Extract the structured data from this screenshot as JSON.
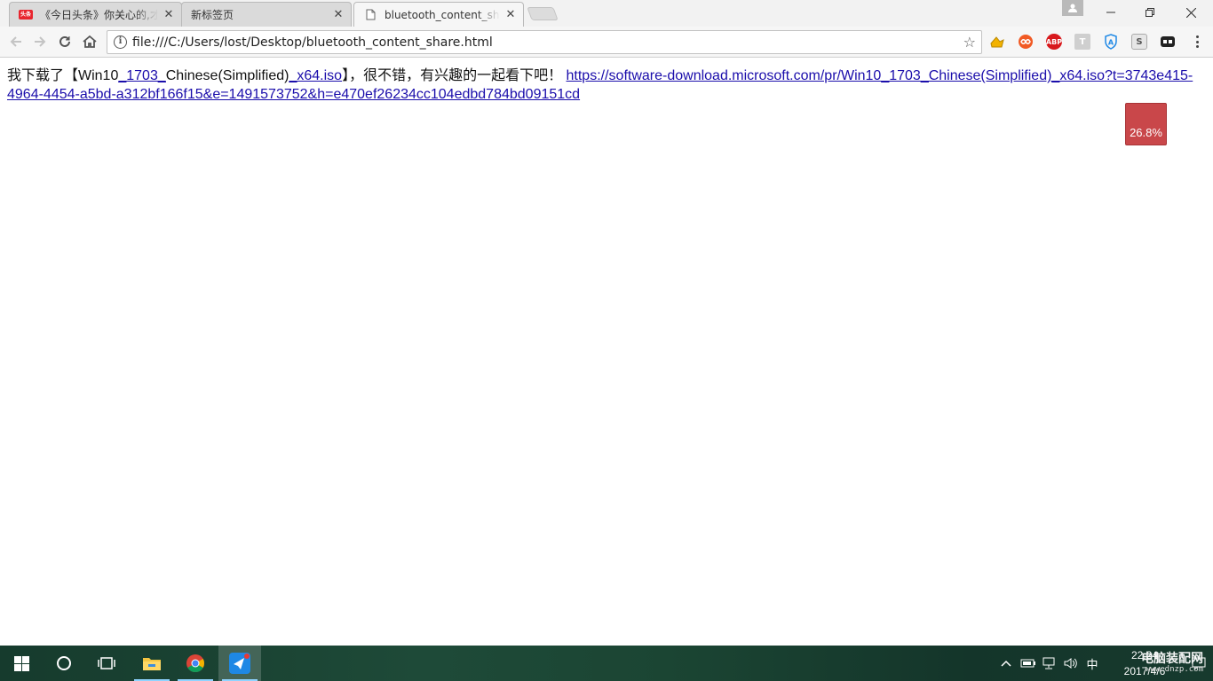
{
  "tabs": [
    {
      "title": "《今日头条》你关心的,才是头条",
      "favicon": "toutiao-logo",
      "favicon_text": "头条",
      "active": false
    },
    {
      "title": "新标签页",
      "favicon": "none",
      "active": false
    },
    {
      "title": "bluetooth_content_share.html",
      "favicon": "page-icon",
      "active": true
    }
  ],
  "omnibox": {
    "url": "file:///C:/Users/lost/Desktop/bluetooth_content_share.html"
  },
  "extensions": [
    "ext-yellow-icon",
    "ext-infinity-icon",
    "adblock-plus-icon",
    "ext-t-icon",
    "ext-shield-a-icon",
    "ext-s-icon",
    "ext-gamepad-icon"
  ],
  "extension_labels": {
    "abp": "ABP",
    "t": "T",
    "a": "A",
    "s": "S"
  },
  "page": {
    "text_before": "我下载了【Win10",
    "text_link1": "_1703_",
    "text_middle": "Chinese(Simplified)",
    "text_link2": "_x64.iso",
    "text_after": "】，很不错，有兴趣的一起看下吧！ ",
    "link_url": "https://software-download.microsoft.com/pr/Win10_1703_Chinese(Simplified)_x64.iso?t=3743e415-4964-4454-a5bd-a312bf166f15&e=1491573752&h=e470ef26234cc104edbd784bd09151cd"
  },
  "progress_badge": {
    "label": "26.8%",
    "value_percent": 26.8,
    "color": "#c9474a"
  },
  "taskbar": {
    "apps": [
      "start-icon",
      "cortana-icon",
      "task-view-icon",
      "file-explorer-icon",
      "chrome-icon",
      "share-app-icon"
    ],
    "tray_ime": "中",
    "clock_time": "22:24",
    "clock_date": "2017/4/6"
  },
  "watermark": {
    "title": "电脑装配网",
    "site": "www.dnzp.com"
  },
  "colors": {
    "accent": "#1a0dab",
    "taskbar": "#1e4a38"
  }
}
